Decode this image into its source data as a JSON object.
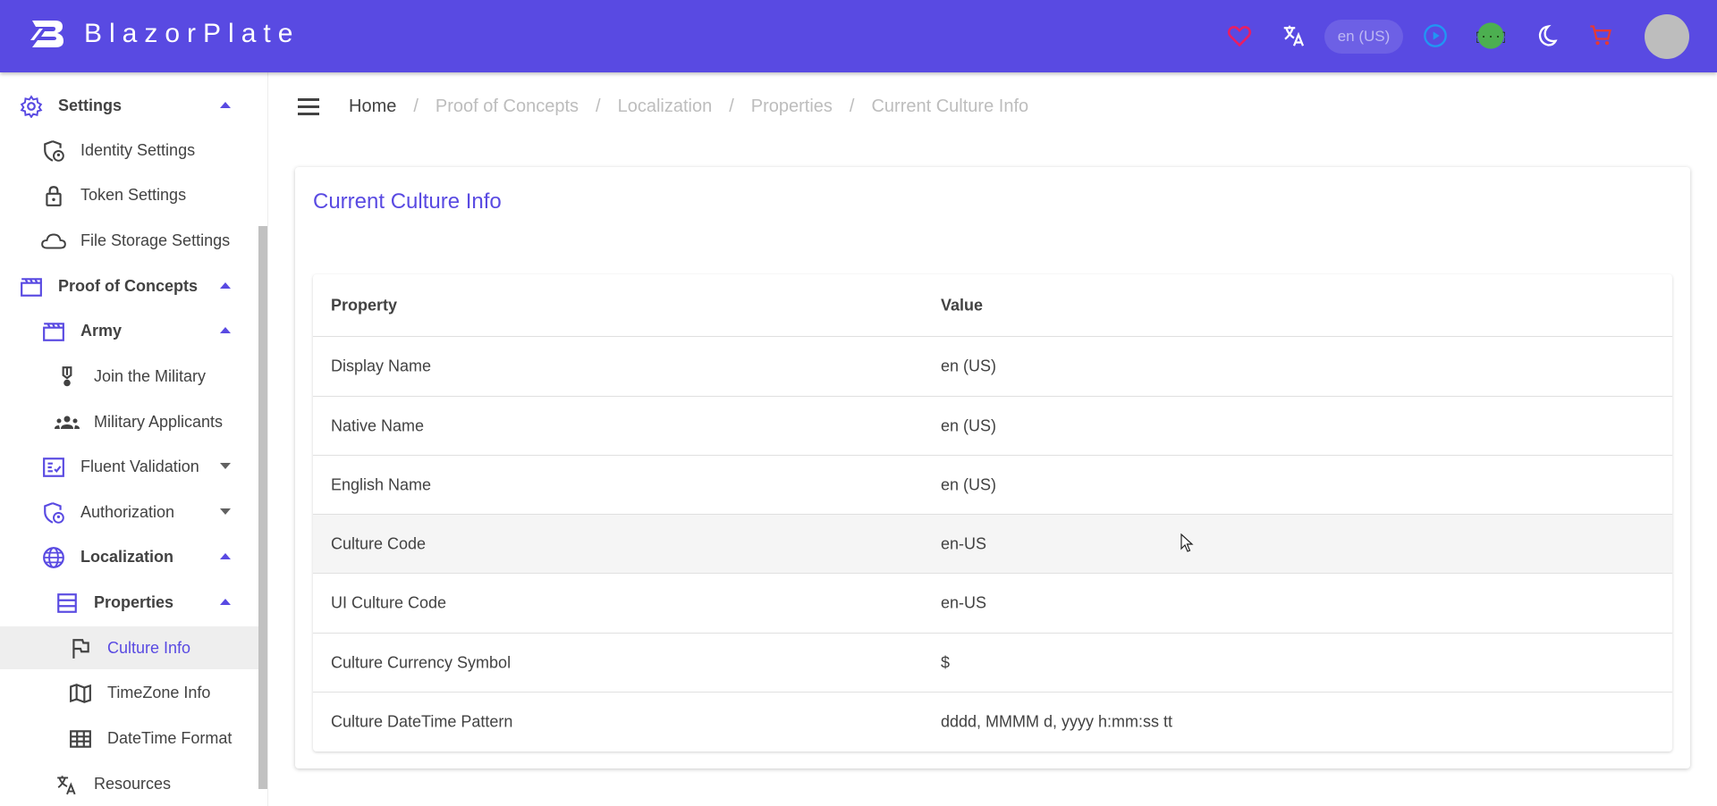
{
  "app": {
    "brand": "BlazorPlate",
    "culture_chip": "en (US)"
  },
  "colors": {
    "primary": "#594ae2",
    "heart": "#e91e63",
    "cart": "#e53935",
    "play": "#2196f3",
    "api": "#4caf50"
  },
  "appbar_icons": [
    "heart-icon",
    "translate-icon",
    "play-icon",
    "api-icon",
    "dark-mode-icon",
    "cart-icon"
  ],
  "sidebar": {
    "items": [
      {
        "label": "Settings",
        "icon": "gear-icon"
      },
      {
        "label": "Identity Settings",
        "icon": "shield-person-icon"
      },
      {
        "label": "Token Settings",
        "icon": "lock-icon"
      },
      {
        "label": "File Storage Settings",
        "icon": "cloud-icon"
      },
      {
        "label": "Proof of Concepts",
        "icon": "clapper-icon"
      },
      {
        "label": "Army",
        "icon": "clapper-icon"
      },
      {
        "label": "Join the Military",
        "icon": "medal-icon"
      },
      {
        "label": "Military Applicants",
        "icon": "groups-icon"
      },
      {
        "label": "Fluent Validation",
        "icon": "checklist-icon"
      },
      {
        "label": "Authorization",
        "icon": "shield-person-icon"
      },
      {
        "label": "Localization",
        "icon": "globe-icon"
      },
      {
        "label": "Properties",
        "icon": "list-icon"
      },
      {
        "label": "Culture Info",
        "icon": "flag-icon"
      },
      {
        "label": "TimeZone Info",
        "icon": "map-icon"
      },
      {
        "label": "DateTime Format",
        "icon": "grid-icon"
      },
      {
        "label": "Resources",
        "icon": "translate-icon"
      }
    ]
  },
  "breadcrumb": [
    "Home",
    "Proof of Concepts",
    "Localization",
    "Properties",
    "Current Culture Info"
  ],
  "card": {
    "title": "Current Culture Info",
    "columns": [
      "Property",
      "Value"
    ],
    "rows": [
      [
        "Display Name",
        "en (US)"
      ],
      [
        "Native Name",
        "en (US)"
      ],
      [
        "English Name",
        "en (US)"
      ],
      [
        "Culture Code",
        "en-US"
      ],
      [
        "UI Culture Code",
        "en-US"
      ],
      [
        "Culture Currency Symbol",
        "$"
      ],
      [
        "Culture DateTime Pattern",
        "dddd, MMMM d, yyyy h:mm:ss tt"
      ]
    ]
  }
}
